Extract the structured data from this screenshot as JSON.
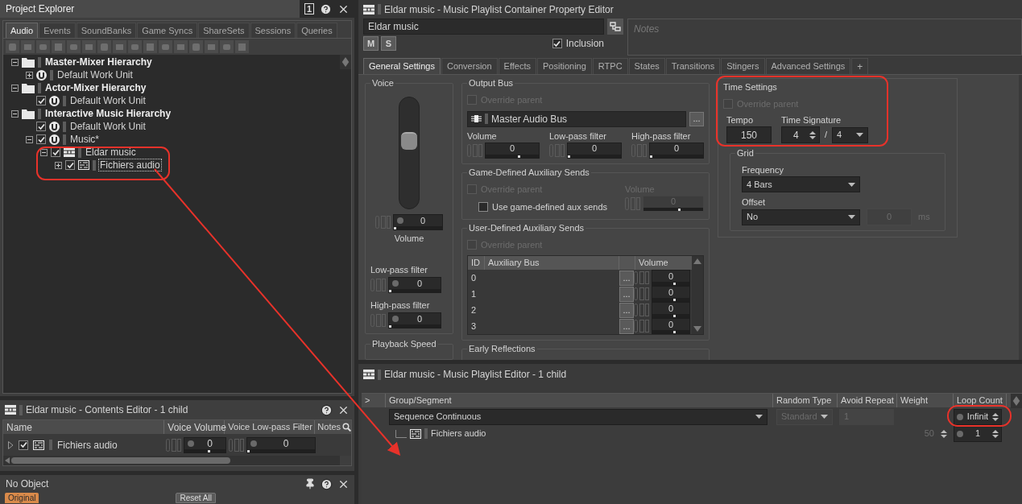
{
  "project_explorer": {
    "title": "Project Explorer",
    "pane_button": "1",
    "tabs": [
      {
        "label": "Audio",
        "selected": true
      },
      {
        "label": "Events",
        "selected": false
      },
      {
        "label": "SoundBanks",
        "selected": false
      },
      {
        "label": "Game Syncs",
        "selected": false
      },
      {
        "label": "ShareSets",
        "selected": false
      },
      {
        "label": "Sessions",
        "selected": false
      },
      {
        "label": "Queries",
        "selected": false
      }
    ],
    "tree": [
      {
        "kind": "hierarchy",
        "label": "Master-Mixer Hierarchy",
        "expanded": true,
        "selected": false,
        "children": [
          {
            "kind": "workunit",
            "label": "Default Work Unit",
            "expanded": false,
            "selected": false
          }
        ]
      },
      {
        "kind": "hierarchy",
        "label": "Actor-Mixer Hierarchy",
        "expanded": true,
        "selected": false,
        "children": [
          {
            "kind": "workunit",
            "label": "Default Work Unit",
            "checked": true,
            "selected": false
          }
        ]
      },
      {
        "kind": "hierarchy",
        "label": "Interactive Music Hierarchy",
        "expanded": true,
        "selected": false,
        "children": [
          {
            "kind": "workunit",
            "label": "Default Work Unit",
            "checked": true,
            "selected": false
          },
          {
            "kind": "workunit",
            "label": "Music*",
            "expanded": true,
            "checked": true,
            "selected": false,
            "children": [
              {
                "kind": "playlist",
                "label": "Eldar music",
                "expanded": true,
                "checked": true,
                "selected": false,
                "children": [
                  {
                    "kind": "segment",
                    "label": "Fichiers audio",
                    "expanded": false,
                    "checked": true,
                    "selected": true
                  }
                ]
              }
            ]
          }
        ]
      }
    ]
  },
  "contents_editor": {
    "title": "Eldar music - Contents Editor - 1 child",
    "columns": [
      "Name",
      "Voice Volume",
      "Voice Low-pass Filter",
      "Notes"
    ],
    "rows": [
      {
        "kind": "segment",
        "name": "Fichiers audio",
        "expanded": false,
        "checked": true,
        "voice_volume": {
          "value": "0",
          "level": 0.6
        },
        "voice_lowpass": {
          "value": "0",
          "level": 0
        }
      }
    ]
  },
  "property_panel": {
    "title": "No Object",
    "buttons": [
      {
        "label": "Original",
        "kind": "accent"
      },
      {
        "label": "Reset All",
        "kind": "plain"
      }
    ]
  },
  "property_editor": {
    "title": "Eldar music - Music Playlist Container Property Editor",
    "name": "Eldar music",
    "mute": "M",
    "solo": "S",
    "inclusion": {
      "label": "Inclusion",
      "checked": true
    },
    "notes_placeholder": "Notes",
    "tabs": [
      {
        "label": "General Settings",
        "selected": true
      },
      {
        "label": "Conversion",
        "selected": false
      },
      {
        "label": "Effects",
        "selected": false
      },
      {
        "label": "Positioning",
        "selected": false
      },
      {
        "label": "RTPC",
        "selected": false
      },
      {
        "label": "States",
        "selected": false
      },
      {
        "label": "Transitions",
        "selected": false
      },
      {
        "label": "Stingers",
        "selected": false
      },
      {
        "label": "Advanced Settings",
        "selected": false
      }
    ],
    "add_tab": "+",
    "voice": {
      "title": "Voice",
      "level": 0.63,
      "fields": [
        {
          "label": "Volume",
          "value": "0",
          "level": 0
        },
        {
          "label": "Low-pass filter",
          "value": "0",
          "level": 0
        },
        {
          "label": "High-pass filter",
          "value": "0",
          "level": 0
        }
      ]
    },
    "playback_speed": {
      "title": "Playback Speed"
    },
    "output_bus": {
      "title": "Output Bus",
      "override": {
        "label": "Override parent",
        "checked": false,
        "disabled": true
      },
      "bus": "Master Audio Bus",
      "browse": "...",
      "fields": [
        {
          "label": "Volume",
          "value": "0",
          "level": 0.63
        },
        {
          "label": "Low-pass filter",
          "value": "0",
          "level": 0
        },
        {
          "label": "High-pass filter",
          "value": "0",
          "level": 0
        }
      ]
    },
    "game_aux": {
      "title": "Game-Defined Auxiliary Sends",
      "override": {
        "label": "Override parent",
        "checked": false,
        "disabled": true
      },
      "use_game_defined": {
        "label": "Use game-defined aux sends",
        "checked": false,
        "disabled": false
      },
      "volume": {
        "label": "Volume",
        "value": "0",
        "level": 0.6,
        "disabled": true
      }
    },
    "user_aux": {
      "title": "User-Defined Auxiliary Sends",
      "override": {
        "label": "Override parent",
        "checked": false,
        "disabled": true
      },
      "columns": [
        "ID",
        "Auxiliary Bus",
        "Volume"
      ],
      "rows": [
        {
          "id": "0",
          "browse": "...",
          "volume": {
            "value": "0",
            "level": 0.6
          }
        },
        {
          "id": "1",
          "browse": "...",
          "volume": {
            "value": "0",
            "level": 0.6
          }
        },
        {
          "id": "2",
          "browse": "...",
          "volume": {
            "value": "0",
            "level": 0.6
          }
        },
        {
          "id": "3",
          "browse": "...",
          "volume": {
            "value": "0",
            "level": 0.6
          }
        }
      ]
    },
    "early_reflections": {
      "title": "Early Reflections"
    },
    "time_settings": {
      "title": "Time Settings",
      "override": {
        "label": "Override parent",
        "checked": false,
        "disabled": true
      },
      "tempo": {
        "label": "Tempo",
        "value": "150"
      },
      "time_signature": {
        "label": "Time Signature",
        "beats": "4",
        "separator": "/",
        "unit": "4"
      }
    },
    "grid": {
      "title": "Grid",
      "frequency": {
        "label": "Frequency",
        "value": "4 Bars"
      },
      "offset": {
        "label": "Offset",
        "value": "No",
        "ms_value": "0",
        "unit": "ms"
      }
    }
  },
  "playlist_editor": {
    "title": "Eldar music - Music Playlist Editor - 1 child",
    "columns": [
      ">",
      "Group/Segment",
      "Random Type",
      "Avoid Repeat",
      "Weight",
      "Loop Count"
    ],
    "rows": [
      {
        "kind": "group",
        "label": "Sequence Continuous",
        "random_type": {
          "value": "Standard",
          "disabled": true
        },
        "avoid_repeat": {
          "value": "1",
          "disabled": true
        },
        "loop_count": "Infinit"
      },
      {
        "kind": "segment",
        "label": "Fichiers audio",
        "weight": {
          "value": "50",
          "disabled": true
        },
        "loop_count": "1"
      }
    ]
  }
}
